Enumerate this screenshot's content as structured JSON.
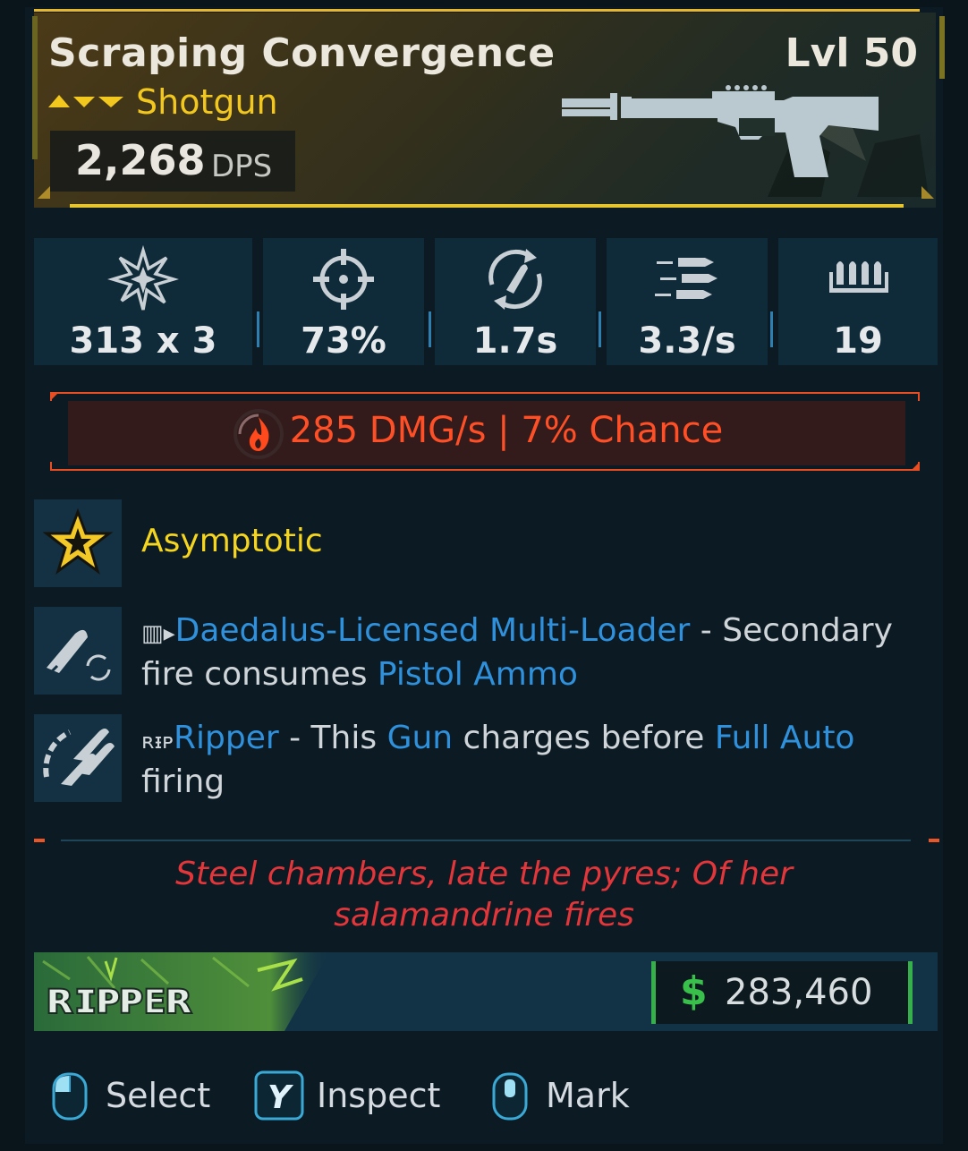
{
  "weapon": {
    "name": "Scraping Convergence",
    "level": "Lvl 50",
    "type": "Shotgun",
    "dps_value": "2,268",
    "dps_label": "DPS",
    "rarity_color": "#f2c81e"
  },
  "stats": [
    {
      "icon": "explosion-damage-icon",
      "value": "313 x 3"
    },
    {
      "icon": "crosshair-accuracy-icon",
      "value": "73%"
    },
    {
      "icon": "reload-bullet-icon",
      "value": "1.7s"
    },
    {
      "icon": "fire-rate-bullets-icon",
      "value": "3.3/s"
    },
    {
      "icon": "magazine-icon",
      "value": "19"
    }
  ],
  "elemental": {
    "icon": "fire-element-icon",
    "text": "285 DMG/s | 7% Chance",
    "color": "#ff4f26"
  },
  "perks": {
    "asymptotic": {
      "icon": "gold-star-icon",
      "title": "Asymptotic"
    },
    "multiloader": {
      "icon": "bullet-reload-icon",
      "name": "Daedalus-Licensed Multi-Loader",
      "sep1": " - Secondary fire consumes ",
      "ammo": "Pistol Ammo"
    },
    "ripper": {
      "icon": "chain-bullets-icon",
      "name": "Ripper",
      "sep1": " - This ",
      "gun": "Gun",
      "mid": " charges before ",
      "fullauto": "Full Auto",
      "end": " firing"
    }
  },
  "flavor": {
    "line1": "Steel chambers, late the pyres; Of her",
    "line2": "salamandrine fires"
  },
  "manufacturer": {
    "logo_text": "RIPPER"
  },
  "price": {
    "symbol": "$",
    "value": "283,460"
  },
  "controls": [
    {
      "icon": "mouse-left-icon",
      "label": "Select"
    },
    {
      "icon": "y-button-icon",
      "key": "Y",
      "label": "Inspect"
    },
    {
      "icon": "mouse-middle-icon",
      "label": "Mark"
    }
  ]
}
